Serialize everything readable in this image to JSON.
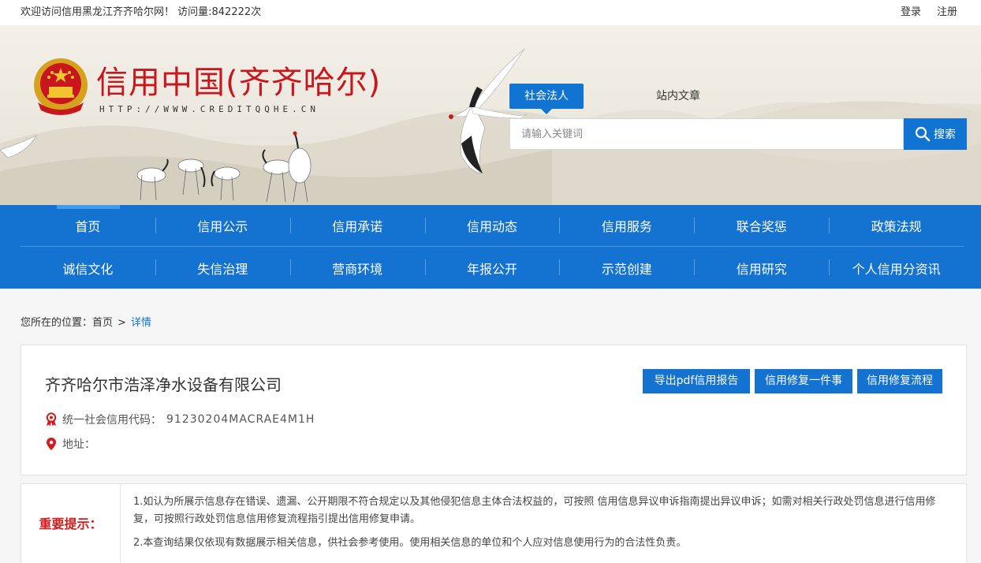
{
  "topbar": {
    "welcome": "欢迎访问信用黑龙江齐齐哈尔网！  访问量:842222次",
    "login": "登录",
    "register": "注册"
  },
  "header": {
    "title": "信用中国(齐齐哈尔)",
    "url": "HTTP://WWW.CREDITQQHE.CN"
  },
  "search": {
    "tabs": [
      "社会法人",
      "站内文章"
    ],
    "placeholder": "请输入关键词",
    "button": "搜索"
  },
  "nav": {
    "row1": [
      "首页",
      "信用公示",
      "信用承诺",
      "信用动态",
      "信用服务",
      "联合奖惩",
      "政策法规"
    ],
    "row2": [
      "诚信文化",
      "失信治理",
      "营商环境",
      "年报公开",
      "示范创建",
      "信用研究",
      "个人信用分资讯"
    ]
  },
  "breadcrumb": {
    "prefix": "您所在的位置：",
    "home": "首页",
    "sep": ">",
    "current": "详情"
  },
  "company": {
    "name": "齐齐哈尔市浩泽净水设备有限公司",
    "buttons": [
      "导出pdf信用报告",
      "信用修复一件事",
      "信用修复流程"
    ],
    "code_label": "统一社会信用代码：",
    "code_value": "91230204MACRAE4M1H",
    "address_label": "地址："
  },
  "notice": {
    "label": "重要提示：",
    "items": [
      "1.如认为所展示信息存在错误、遗漏、公开期限不符合规定以及其他侵犯信息主体合法权益的，可按照 信用信息异议申诉指南提出异议申诉；如需对相关行政处罚信息进行信用修复，可按照行政处罚信息信用修复流程指引提出信用修复申请。",
      "2.本查询结果仅依现有数据展示相关信息，供社会参考使用。使用相关信息的单位和个人应对信息使用行为的合法性负责。"
    ]
  },
  "colors": {
    "brand_blue": "#1472d1",
    "title_red": "#c8161d",
    "notice_red": "#d61a1a"
  }
}
